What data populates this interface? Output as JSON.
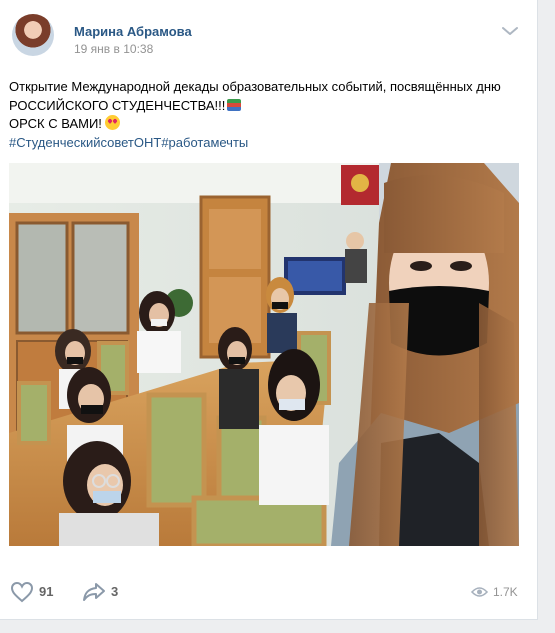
{
  "post": {
    "author": "Марина Абрамова",
    "date": "19 янв в 10:38",
    "text_line1": "Открытие Международной декады образовательных событий, посвящённых дню",
    "text_line2": "РОССИЙСКОГО СТУДЕНЧЕСТВА!!!",
    "text_line3": "ОРСК С ВАМИ!",
    "hashtags": "#СтуденческийсоветОНТ#работамечты",
    "likes": "91",
    "shares": "3",
    "views": "1.7K"
  },
  "icons": {
    "more": "chevron-down-icon",
    "like": "heart-icon",
    "share": "share-arrow-icon",
    "views": "eye-icon"
  },
  "colors": {
    "link": "#2a5885",
    "muted": "#939393",
    "background": "#edeef0"
  }
}
